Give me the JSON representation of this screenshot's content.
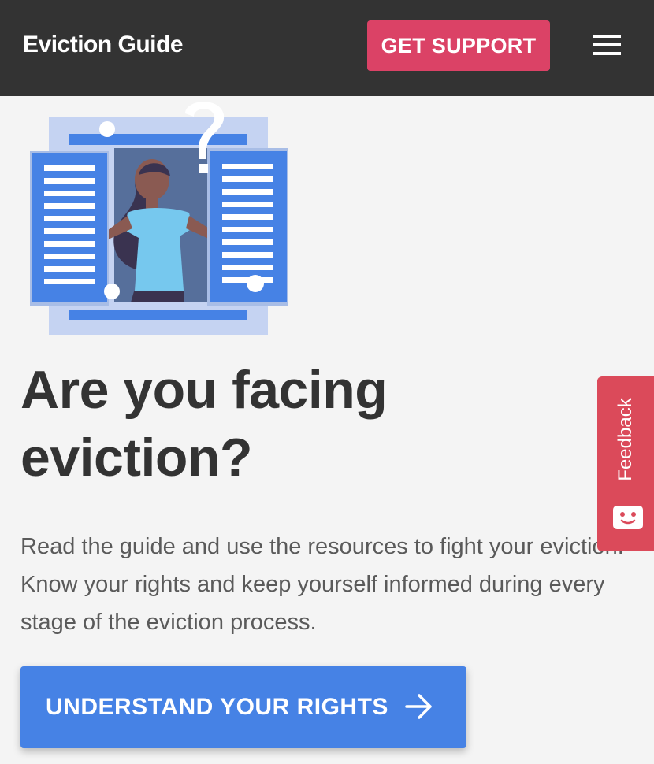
{
  "header": {
    "brand": "Eviction Guide",
    "support_label": "GET SUPPORT",
    "menu_icon": "hamburger-menu-icon"
  },
  "hero": {
    "illustration": "woman-at-window-question-illustration",
    "headline": "Are you facing eviction?",
    "intro": "Read the guide and use the resources to fight your eviction. Know your rights and keep yourself informed during every stage of the eviction process.",
    "cta_label": "UNDERSTAND YOUR RIGHTS",
    "cta_icon": "arrow-right-icon"
  },
  "feedback": {
    "label": "Feedback",
    "icon": "smiley-chat-icon"
  },
  "colors": {
    "header_bg": "#333333",
    "support_button": "#db4266",
    "cta_button": "#4682e5",
    "feedback_tab": "#db4a5a",
    "page_bg": "#f4f4f4"
  }
}
